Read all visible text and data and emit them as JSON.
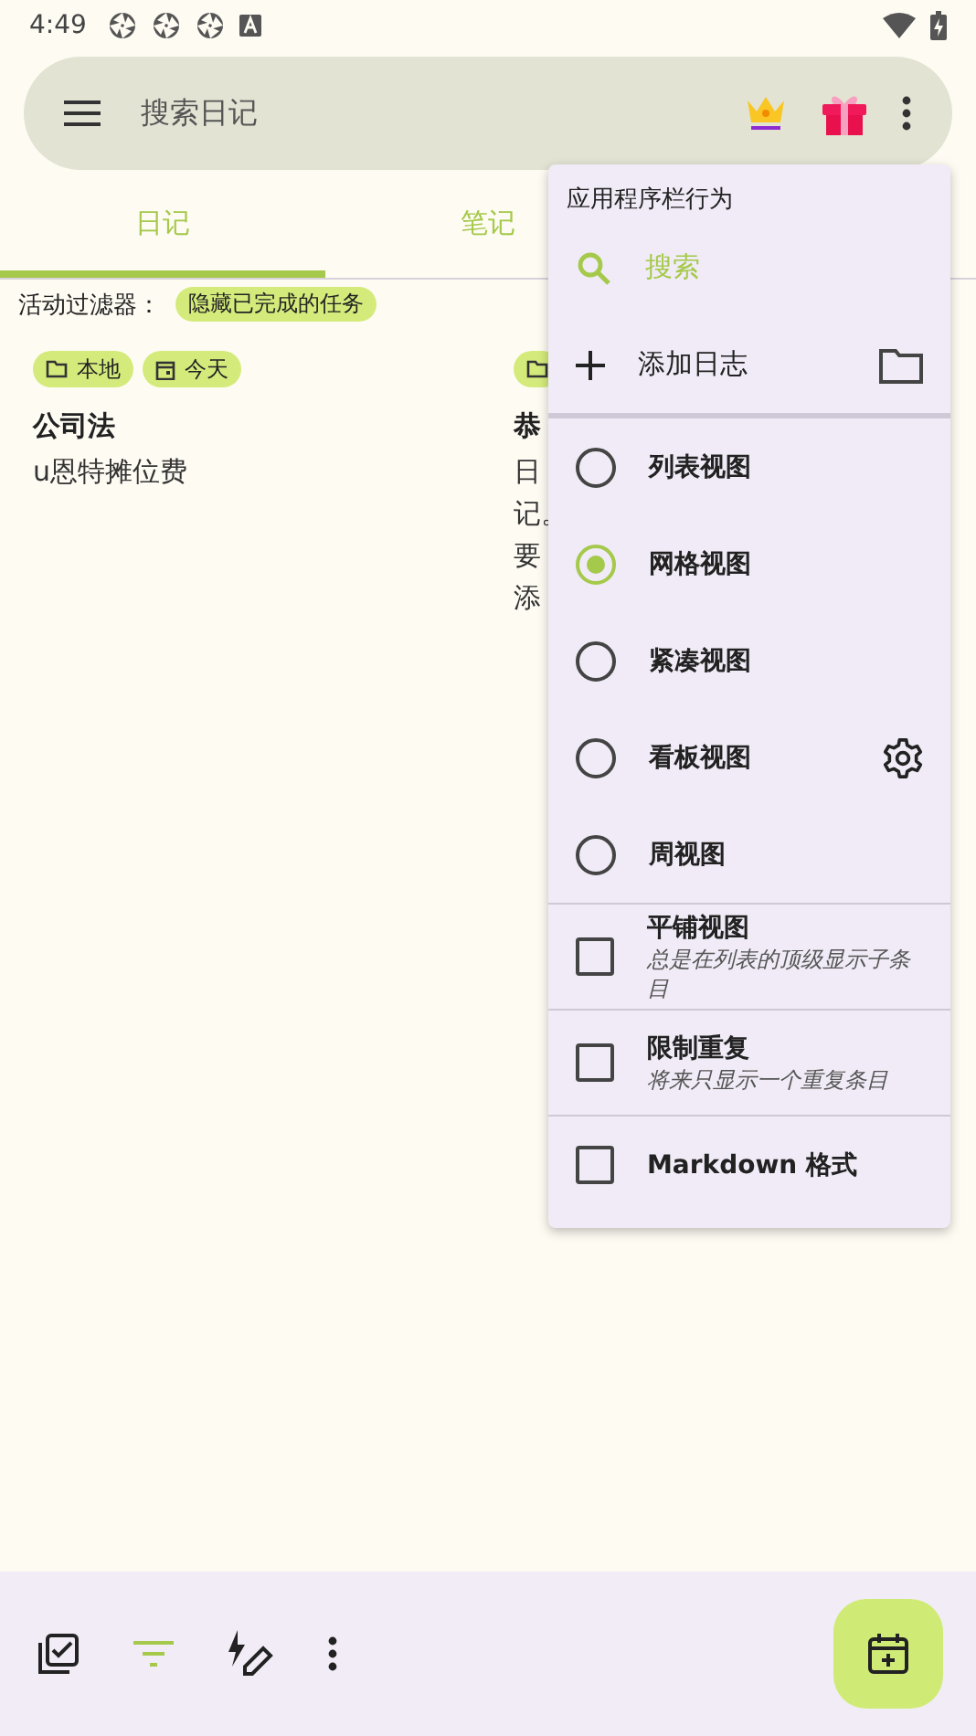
{
  "status_bar": {
    "time": "4:49"
  },
  "search_bar": {
    "placeholder": "搜索日记"
  },
  "tabs": [
    {
      "label": "日记",
      "selected": true
    },
    {
      "label": "笔记",
      "selected": false
    }
  ],
  "filter": {
    "label": "活动过滤器：",
    "chips": [
      "隐藏已完成的任务"
    ]
  },
  "cards": [
    {
      "tags": [
        {
          "kind": "folder",
          "label": "本地"
        },
        {
          "kind": "date",
          "label": "今天"
        }
      ],
      "title": "公司法",
      "body": [
        "u恩特摊位费"
      ]
    },
    {
      "tags": [
        {
          "kind": "folder"
        }
      ],
      "title": "恭",
      "body": [
        "日",
        "记。",
        "要",
        "添"
      ]
    }
  ],
  "menu": {
    "header": "应用程序栏行为",
    "search": "搜索",
    "add": "添加日志",
    "items": [
      {
        "kind": "radio",
        "label": "列表视图",
        "selected": false
      },
      {
        "kind": "radio",
        "label": "网格视图",
        "selected": true
      },
      {
        "kind": "radio",
        "label": "紧凑视图",
        "selected": false
      },
      {
        "kind": "radio",
        "label": "看板视图",
        "selected": false,
        "settings": true
      },
      {
        "kind": "radio",
        "label": "周视图",
        "selected": false
      },
      {
        "kind": "checkbox",
        "label": "平铺视图",
        "subtitle": "总是在列表的顶级显示子条目",
        "checked": false
      },
      {
        "kind": "checkbox",
        "label": "限制重复",
        "subtitle": "将来只显示一个重复条目",
        "checked": false
      },
      {
        "kind": "checkbox",
        "label": "Markdown 格式",
        "checked": false
      }
    ]
  },
  "bottom_bar": {
    "actions": [
      {
        "kind": "select",
        "active": false
      },
      {
        "kind": "filter",
        "active": true
      },
      {
        "kind": "quick",
        "active": false
      },
      {
        "kind": "more",
        "active": false
      }
    ]
  }
}
